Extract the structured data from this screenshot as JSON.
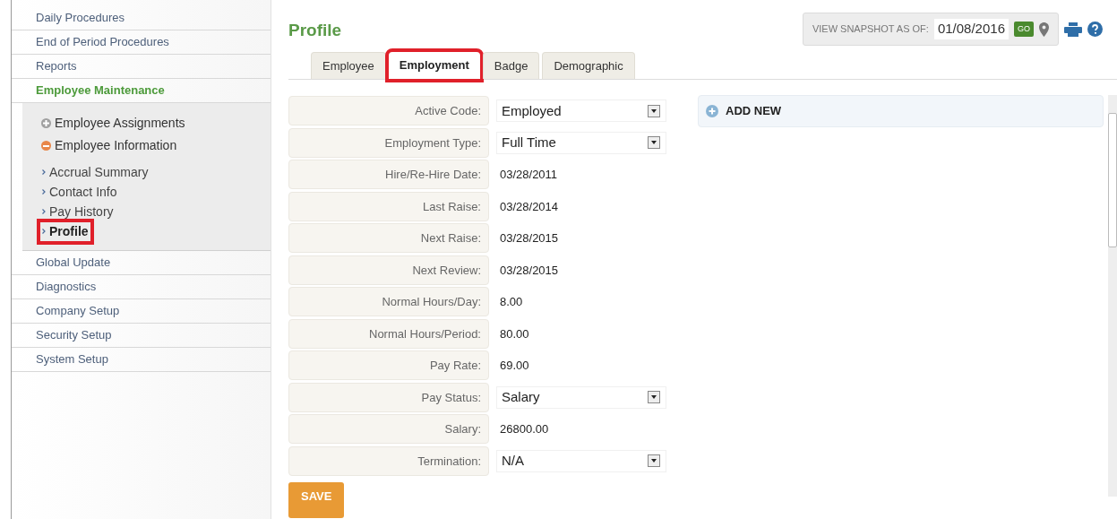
{
  "sidebar": {
    "items": [
      {
        "label": "Daily Procedures",
        "selected": false
      },
      {
        "label": "End of Period Procedures",
        "selected": false
      },
      {
        "label": "Reports",
        "selected": false
      },
      {
        "label": "Employee Maintenance",
        "selected": true,
        "children": [
          {
            "label": "Employee Assignments",
            "expanded": false
          },
          {
            "label": "Employee Information",
            "expanded": true,
            "children": [
              {
                "label": "Accrual Summary",
                "selected": false,
                "highlighted": false
              },
              {
                "label": "Contact Info",
                "selected": false,
                "highlighted": false
              },
              {
                "label": "Pay History",
                "selected": false,
                "highlighted": false
              },
              {
                "label": "Profile",
                "selected": true,
                "highlighted": true
              }
            ]
          }
        ]
      },
      {
        "label": "Global Update",
        "selected": false
      },
      {
        "label": "Diagnostics",
        "selected": false
      },
      {
        "label": "Company Setup",
        "selected": false
      },
      {
        "label": "Security Setup",
        "selected": false
      },
      {
        "label": "System Setup",
        "selected": false
      }
    ]
  },
  "page": {
    "title": "Profile"
  },
  "snapshot": {
    "label": "VIEW SNAPSHOT AS OF:",
    "date": "01/08/2016",
    "button": "GO"
  },
  "tabs": [
    {
      "label": "Employee",
      "selected": false,
      "highlighted": false
    },
    {
      "label": "Employment",
      "selected": true,
      "highlighted": true
    },
    {
      "label": "Badge",
      "selected": false,
      "highlighted": false
    },
    {
      "label": "Demographic",
      "selected": false,
      "highlighted": false
    }
  ],
  "fields": [
    {
      "label": "Active Code:",
      "kind": "select",
      "value": "Employed"
    },
    {
      "label": "Employment Type:",
      "kind": "select",
      "value": "Full Time"
    },
    {
      "label": "Hire/Re-Hire Date:",
      "kind": "text",
      "value": "03/28/2011"
    },
    {
      "label": "Last Raise:",
      "kind": "text",
      "value": "03/28/2014"
    },
    {
      "label": "Next Raise:",
      "kind": "text",
      "value": "03/28/2015"
    },
    {
      "label": "Next Review:",
      "kind": "text",
      "value": "03/28/2015"
    },
    {
      "label": "Normal Hours/Day:",
      "kind": "text",
      "value": "8.00"
    },
    {
      "label": "Normal Hours/Period:",
      "kind": "text",
      "value": "80.00"
    },
    {
      "label": "Pay Rate:",
      "kind": "text",
      "value": "69.00"
    },
    {
      "label": "Pay Status:",
      "kind": "select",
      "value": "Salary"
    },
    {
      "label": "Salary:",
      "kind": "text",
      "value": "26800.00"
    },
    {
      "label": "Termination:",
      "kind": "select",
      "value": "N/A"
    }
  ],
  "save_button": "SAVE",
  "side_panel": {
    "add_new": "ADD NEW"
  }
}
